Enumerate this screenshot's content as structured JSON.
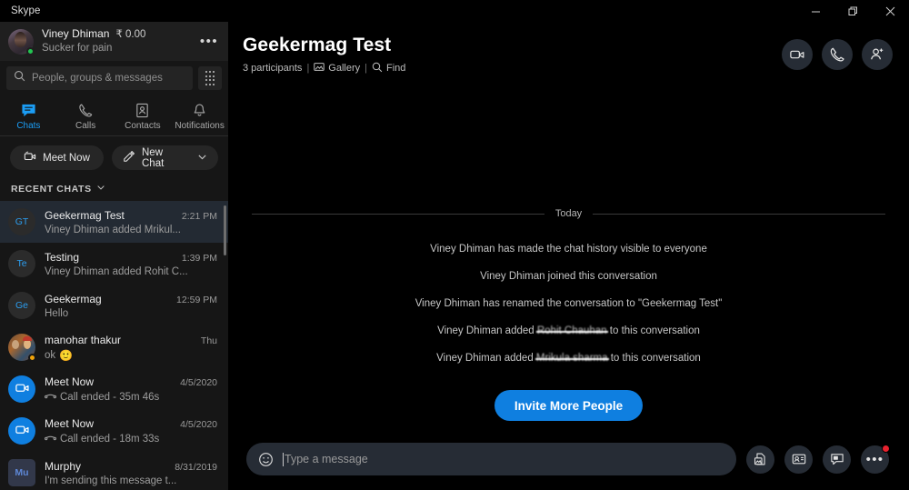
{
  "window": {
    "app_title": "Skype",
    "controls": [
      {
        "name": "minimize",
        "glyph": "minimize-icon"
      },
      {
        "name": "restore",
        "glyph": "restore-icon"
      },
      {
        "name": "close",
        "glyph": "close-icon"
      }
    ]
  },
  "sidebar": {
    "profile": {
      "name": "Viney Dhiman",
      "balance": "₹ 0.00",
      "mood": "Sucker for pain",
      "presence": "online",
      "more_label": "•••"
    },
    "search": {
      "placeholder": "People, groups & messages",
      "icon": "search-icon",
      "dialpad_icon": "dialpad-icon"
    },
    "tabs": [
      {
        "label": "Chats",
        "icon": "chat-icon",
        "active": true
      },
      {
        "label": "Calls",
        "icon": "phone-icon",
        "active": false
      },
      {
        "label": "Contacts",
        "icon": "contacts-icon",
        "active": false
      },
      {
        "label": "Notifications",
        "icon": "bell-icon",
        "active": false
      }
    ],
    "actions": {
      "meet_now": "Meet Now",
      "meet_now_icon": "video-icon",
      "new_chat": "New Chat",
      "new_chat_icon": "compose-icon",
      "new_chat_chevron": "chevron-down-icon"
    },
    "recent_header": {
      "label": "RECENT CHATS",
      "chevron": "chevron-down-icon"
    },
    "chats": [
      {
        "title": "Geekermag Test",
        "time": "2:21 PM",
        "preview": "Viney Dhiman added Mrikul...",
        "avatar_type": "initials",
        "avatar_text": "GT",
        "selected": true
      },
      {
        "title": "Testing",
        "time": "1:39 PM",
        "preview": "Viney Dhiman added Rohit C...",
        "avatar_type": "initials",
        "avatar_text": "Te",
        "selected": false
      },
      {
        "title": "Geekermag",
        "time": "12:59 PM",
        "preview": "Hello",
        "avatar_type": "initials",
        "avatar_text": "Ge",
        "selected": false
      },
      {
        "title": "manohar thakur",
        "time": "Thu",
        "preview": "ok",
        "preview_emoji": "🙂",
        "avatar_type": "photo",
        "avatar_text": "",
        "presence": "away",
        "selected": false
      },
      {
        "title": "Meet Now",
        "time": "4/5/2020",
        "preview": "Call ended - 35m 46s",
        "preview_icon": "call-ended-icon",
        "avatar_type": "blue-video",
        "avatar_text": "",
        "selected": false
      },
      {
        "title": "Meet Now",
        "time": "4/5/2020",
        "preview": "Call ended - 18m 33s",
        "preview_icon": "call-ended-icon",
        "avatar_type": "blue-video",
        "avatar_text": "",
        "selected": false
      },
      {
        "title": "Murphy",
        "time": "8/31/2019",
        "preview": "I'm sending this message t...",
        "avatar_type": "square",
        "avatar_text": "Mu",
        "selected": false
      }
    ]
  },
  "conversation": {
    "title": "Geekermag Test",
    "participants": "3 participants",
    "gallery": "Gallery",
    "gallery_icon": "gallery-icon",
    "find": "Find",
    "find_icon": "search-icon",
    "separator": "|",
    "header_buttons": [
      {
        "name": "video-call-button",
        "icon": "video-icon"
      },
      {
        "name": "audio-call-button",
        "icon": "phone-icon"
      },
      {
        "name": "add-people-button",
        "icon": "add-person-icon"
      }
    ],
    "day_divider": "Today",
    "messages": [
      {
        "type": "system",
        "text": "Viney Dhiman has made the chat history visible to everyone"
      },
      {
        "type": "system",
        "text": "Viney Dhiman joined this conversation"
      },
      {
        "type": "system",
        "text": "Viney Dhiman has renamed the conversation to \"Geekermag Test\""
      },
      {
        "type": "system-redacted",
        "prefix": "Viney Dhiman added ",
        "redacted": "Rohit Chauhan",
        "suffix": " to this conversation"
      },
      {
        "type": "system-redacted",
        "prefix": "Viney Dhiman added ",
        "redacted": "Mrikula sharma",
        "suffix": " to this conversation"
      }
    ],
    "invite_button": "Invite More People",
    "composer": {
      "emoji_icon": "emoji-icon",
      "placeholder": "Type a message",
      "value": "",
      "buttons": [
        {
          "name": "send-image-button",
          "icon": "image-icon",
          "badge": false
        },
        {
          "name": "send-contact-button",
          "icon": "contact-card-icon",
          "badge": false
        },
        {
          "name": "send-sticker-button",
          "icon": "sticker-icon",
          "badge": false
        },
        {
          "name": "more-options-button",
          "icon": "more-dots-icon",
          "badge": true
        }
      ]
    }
  },
  "colors": {
    "accent": "#0f7fe0",
    "sidebar_bg": "#161616",
    "panel_bg": "#000000",
    "selected_row": "#232a33",
    "button_bg": "#262c35",
    "online": "#23c552",
    "away": "#f0a30a",
    "badge": "#e8222e"
  }
}
